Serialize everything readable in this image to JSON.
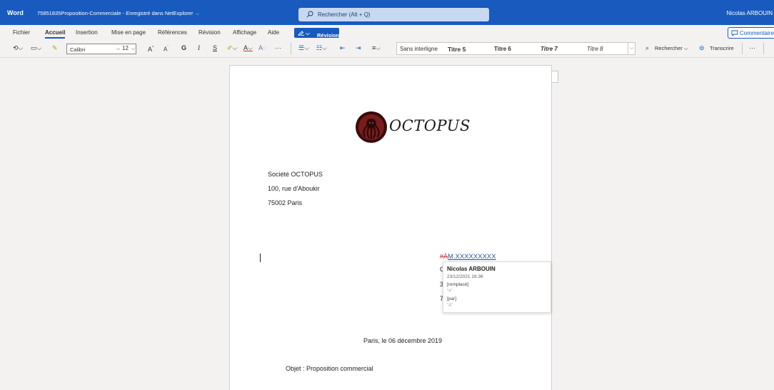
{
  "titlebar": {
    "app": "Word",
    "document": "75851835Proposition-Commerciale - Enregistré dans NetExplorer",
    "search_placeholder": "Rechercher (Alt + Q)",
    "user": "Nicolas ARBOUIN"
  },
  "menu": {
    "items": [
      "Fichier",
      "Accueil",
      "Insertion",
      "Mise en page",
      "Références",
      "Révision",
      "Affichage",
      "Aide"
    ],
    "active": "Accueil",
    "revision_button": "Révision",
    "comments_button": "Commentaires"
  },
  "ribbon": {
    "font": "Calibri",
    "size": "12",
    "grow_font": "A",
    "shrink_font": "A",
    "bold": "G",
    "italic": "I",
    "underline": "S",
    "ellipsis": "···",
    "styles": [
      "Sans interligne",
      "Titre 5",
      "Titre 6",
      "Titre 7",
      "Titre 8"
    ],
    "find": "Rechercher",
    "dictate": "Transcrire",
    "more": "···"
  },
  "document": {
    "logo_text": "OCTOPUS",
    "address": [
      "Société OCTOPUS",
      "100, rue d'Aboukir",
      "75002 Paris"
    ],
    "tracked_mark": "#À",
    "tracked_text": "M.XXXXXXXXX",
    "hidden_fragments": [
      "C",
      "3",
      "7"
    ],
    "date_line": "Paris, le 06 décembre 2019",
    "object_line": "Objet : Proposition commercial"
  },
  "revision_popup": {
    "author": "Nicolas ARBOUIN",
    "date": "23/12/2021 16:36",
    "action1": "[remplacé]",
    "quote1": "\"#\"",
    "action2": "[par]",
    "quote2": "\"À\""
  },
  "colors": {
    "brand": "#185abd",
    "tracked_change": "#d13438",
    "inserted_text": "#2b579a"
  }
}
